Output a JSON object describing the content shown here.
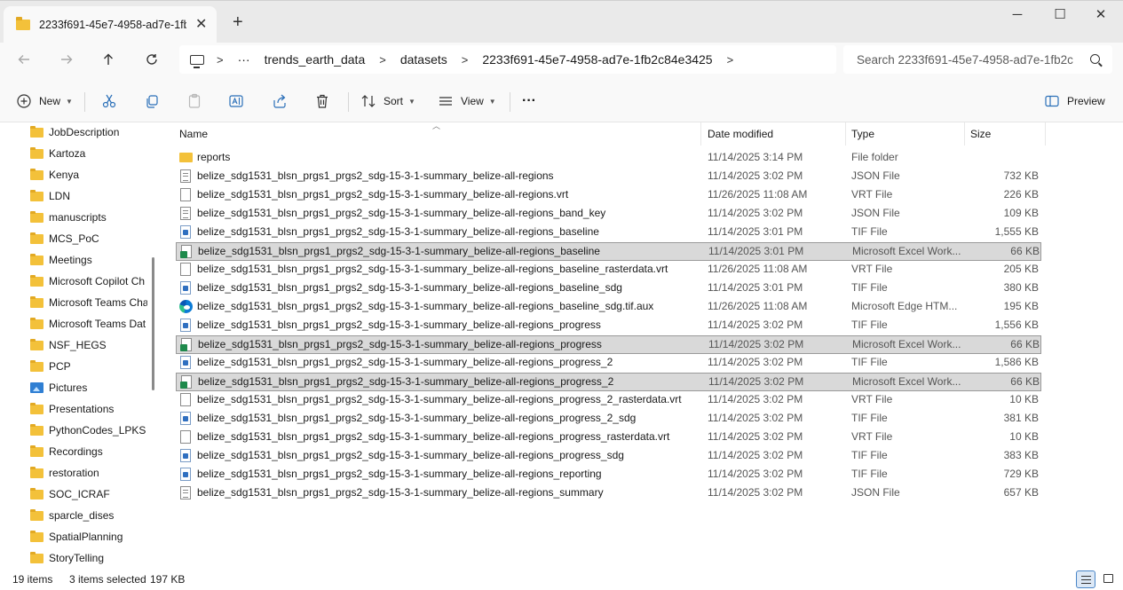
{
  "window": {
    "tab_title": "2233f691-45e7-4958-ad7e-1fb",
    "tab_close": "✕",
    "new_tab": "+",
    "minimize": "─",
    "maximize": "☐",
    "close": "✕"
  },
  "address": {
    "ellipsis": "···",
    "crumbs": [
      "trends_earth_data",
      "datasets",
      "2233f691-45e7-4958-ad7e-1fb2c84e3425"
    ],
    "sep": ">"
  },
  "search": {
    "placeholder": "Search 2233f691-45e7-4958-ad7e-1fb2c"
  },
  "toolbar": {
    "new_label": "New",
    "sort_label": "Sort",
    "view_label": "View",
    "more_label": "···",
    "preview_label": "Preview"
  },
  "nav": {
    "items": [
      {
        "label": "JobDescription",
        "icon": "folder-icon"
      },
      {
        "label": "Kartoza",
        "icon": "folder-icon"
      },
      {
        "label": "Kenya",
        "icon": "folder-icon"
      },
      {
        "label": "LDN",
        "icon": "folder-icon"
      },
      {
        "label": "manuscripts",
        "icon": "folder-icon"
      },
      {
        "label": "MCS_PoC",
        "icon": "folder-icon"
      },
      {
        "label": "Meetings",
        "icon": "folder-icon"
      },
      {
        "label": "Microsoft Copilot Ch",
        "icon": "folder-icon"
      },
      {
        "label": "Microsoft Teams Cha",
        "icon": "folder-icon"
      },
      {
        "label": "Microsoft Teams Dat",
        "icon": "folder-icon"
      },
      {
        "label": "NSF_HEGS",
        "icon": "folder-icon"
      },
      {
        "label": "PCP",
        "icon": "folder-icon"
      },
      {
        "label": "Pictures",
        "icon": "pictures-icon"
      },
      {
        "label": "Presentations",
        "icon": "folder-icon"
      },
      {
        "label": "PythonCodes_LPKS",
        "icon": "folder-icon"
      },
      {
        "label": "Recordings",
        "icon": "folder-icon"
      },
      {
        "label": "restoration",
        "icon": "folder-icon"
      },
      {
        "label": "SOC_ICRAF",
        "icon": "folder-icon"
      },
      {
        "label": "sparcle_dises",
        "icon": "folder-icon"
      },
      {
        "label": "SpatialPlanning",
        "icon": "folder-icon"
      },
      {
        "label": "StoryTelling",
        "icon": "folder-icon"
      }
    ]
  },
  "columns": {
    "name": "Name",
    "date": "Date modified",
    "type": "Type",
    "size": "Size"
  },
  "files": [
    {
      "name": "reports",
      "date": "11/14/2025 3:14 PM",
      "type": "File folder",
      "size": "",
      "icon": "folder",
      "selected": false
    },
    {
      "name": "belize_sdg1531_blsn_prgs1_prgs2_sdg-15-3-1-summary_belize-all-regions",
      "date": "11/14/2025 3:02 PM",
      "type": "JSON File",
      "size": "732 KB",
      "icon": "json",
      "selected": false
    },
    {
      "name": "belize_sdg1531_blsn_prgs1_prgs2_sdg-15-3-1-summary_belize-all-regions.vrt",
      "date": "11/26/2025 11:08 AM",
      "type": "VRT File",
      "size": "226 KB",
      "icon": "vrt",
      "selected": false
    },
    {
      "name": "belize_sdg1531_blsn_prgs1_prgs2_sdg-15-3-1-summary_belize-all-regions_band_key",
      "date": "11/14/2025 3:02 PM",
      "type": "JSON File",
      "size": "109 KB",
      "icon": "json",
      "selected": false
    },
    {
      "name": "belize_sdg1531_blsn_prgs1_prgs2_sdg-15-3-1-summary_belize-all-regions_baseline",
      "date": "11/14/2025 3:01 PM",
      "type": "TIF File",
      "size": "1,555 KB",
      "icon": "tif",
      "selected": false
    },
    {
      "name": "belize_sdg1531_blsn_prgs1_prgs2_sdg-15-3-1-summary_belize-all-regions_baseline",
      "date": "11/14/2025 3:01 PM",
      "type": "Microsoft Excel Work...",
      "size": "66 KB",
      "icon": "xls",
      "selected": true
    },
    {
      "name": "belize_sdg1531_blsn_prgs1_prgs2_sdg-15-3-1-summary_belize-all-regions_baseline_rasterdata.vrt",
      "date": "11/26/2025 11:08 AM",
      "type": "VRT File",
      "size": "205 KB",
      "icon": "vrt",
      "selected": false
    },
    {
      "name": "belize_sdg1531_blsn_prgs1_prgs2_sdg-15-3-1-summary_belize-all-regions_baseline_sdg",
      "date": "11/14/2025 3:01 PM",
      "type": "TIF File",
      "size": "380 KB",
      "icon": "tif",
      "selected": false
    },
    {
      "name": "belize_sdg1531_blsn_prgs1_prgs2_sdg-15-3-1-summary_belize-all-regions_baseline_sdg.tif.aux",
      "date": "11/26/2025 11:08 AM",
      "type": "Microsoft Edge HTM...",
      "size": "195 KB",
      "icon": "edge",
      "selected": false
    },
    {
      "name": "belize_sdg1531_blsn_prgs1_prgs2_sdg-15-3-1-summary_belize-all-regions_progress",
      "date": "11/14/2025 3:02 PM",
      "type": "TIF File",
      "size": "1,556 KB",
      "icon": "tif",
      "selected": false
    },
    {
      "name": "belize_sdg1531_blsn_prgs1_prgs2_sdg-15-3-1-summary_belize-all-regions_progress",
      "date": "11/14/2025 3:02 PM",
      "type": "Microsoft Excel Work...",
      "size": "66 KB",
      "icon": "xls",
      "selected": true
    },
    {
      "name": "belize_sdg1531_blsn_prgs1_prgs2_sdg-15-3-1-summary_belize-all-regions_progress_2",
      "date": "11/14/2025 3:02 PM",
      "type": "TIF File",
      "size": "1,586 KB",
      "icon": "tif",
      "selected": false
    },
    {
      "name": "belize_sdg1531_blsn_prgs1_prgs2_sdg-15-3-1-summary_belize-all-regions_progress_2",
      "date": "11/14/2025 3:02 PM",
      "type": "Microsoft Excel Work...",
      "size": "66 KB",
      "icon": "xls",
      "selected": true
    },
    {
      "name": "belize_sdg1531_blsn_prgs1_prgs2_sdg-15-3-1-summary_belize-all-regions_progress_2_rasterdata.vrt",
      "date": "11/14/2025 3:02 PM",
      "type": "VRT File",
      "size": "10 KB",
      "icon": "vrt",
      "selected": false
    },
    {
      "name": "belize_sdg1531_blsn_prgs1_prgs2_sdg-15-3-1-summary_belize-all-regions_progress_2_sdg",
      "date": "11/14/2025 3:02 PM",
      "type": "TIF File",
      "size": "381 KB",
      "icon": "tif",
      "selected": false
    },
    {
      "name": "belize_sdg1531_blsn_prgs1_prgs2_sdg-15-3-1-summary_belize-all-regions_progress_rasterdata.vrt",
      "date": "11/14/2025 3:02 PM",
      "type": "VRT File",
      "size": "10 KB",
      "icon": "vrt",
      "selected": false
    },
    {
      "name": "belize_sdg1531_blsn_prgs1_prgs2_sdg-15-3-1-summary_belize-all-regions_progress_sdg",
      "date": "11/14/2025 3:02 PM",
      "type": "TIF File",
      "size": "383 KB",
      "icon": "tif",
      "selected": false
    },
    {
      "name": "belize_sdg1531_blsn_prgs1_prgs2_sdg-15-3-1-summary_belize-all-regions_reporting",
      "date": "11/14/2025 3:02 PM",
      "type": "TIF File",
      "size": "729 KB",
      "icon": "tif",
      "selected": false
    },
    {
      "name": "belize_sdg1531_blsn_prgs1_prgs2_sdg-15-3-1-summary_belize-all-regions_summary",
      "date": "11/14/2025 3:02 PM",
      "type": "JSON File",
      "size": "657 KB",
      "icon": "json",
      "selected": false
    }
  ],
  "status": {
    "item_count": "19 items",
    "selected": "3 items selected",
    "selected_size": "197 KB"
  }
}
